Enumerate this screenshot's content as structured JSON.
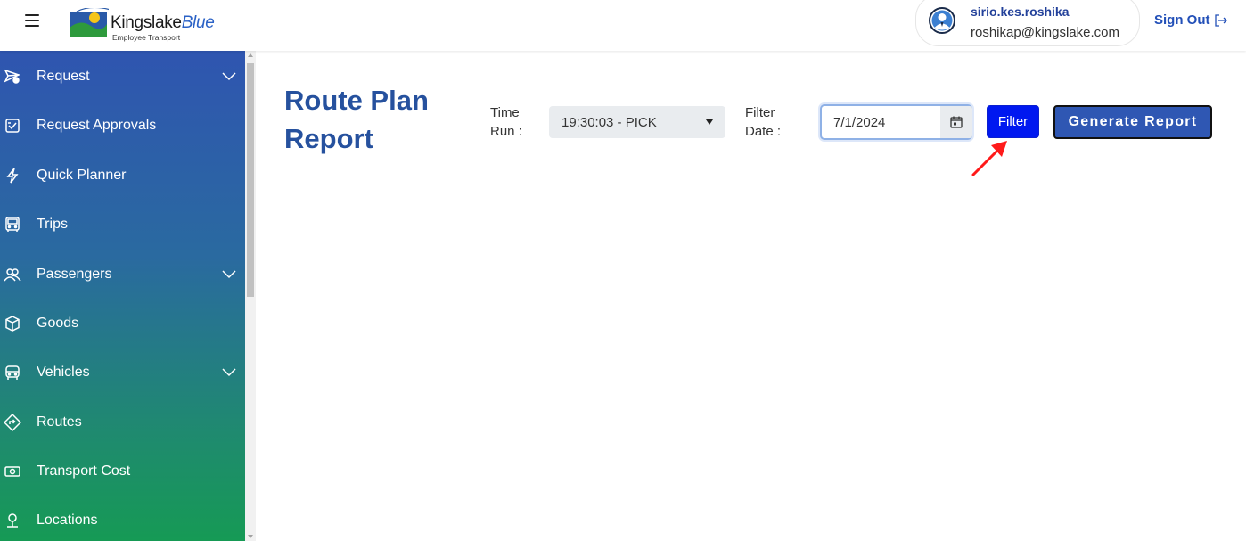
{
  "header": {
    "logo_name_main": "Kingslake",
    "logo_name_accent": "Blue",
    "logo_tagline": "Employee Transport",
    "user_name": "sirio.kes.roshika",
    "user_email": "roshikap@kingslake.com",
    "signout_label": "Sign Out"
  },
  "sidebar": {
    "items": [
      {
        "label": "Request",
        "icon": "paper-plane-icon",
        "expandable": true
      },
      {
        "label": "Request Approvals",
        "icon": "checkbox-icon",
        "expandable": false
      },
      {
        "label": "Quick Planner",
        "icon": "lightning-icon",
        "expandable": false
      },
      {
        "label": "Trips",
        "icon": "bus-front-icon",
        "expandable": false
      },
      {
        "label": "Passengers",
        "icon": "people-icon",
        "expandable": true
      },
      {
        "label": "Goods",
        "icon": "box-icon",
        "expandable": false
      },
      {
        "label": "Vehicles",
        "icon": "bus-icon",
        "expandable": true
      },
      {
        "label": "Routes",
        "icon": "sign-icon",
        "expandable": false
      },
      {
        "label": "Transport Cost",
        "icon": "cash-icon",
        "expandable": false
      },
      {
        "label": "Locations",
        "icon": "location-pin-icon",
        "expandable": false
      }
    ]
  },
  "main": {
    "title": "Route Plan Report",
    "time_run_label": "Time Run :",
    "time_run_value": "19:30:03 - PICK",
    "filter_date_label": "Filter Date :",
    "filter_date_value": "7/1/2024",
    "filter_button": "Filter",
    "generate_button": "Generate Report"
  },
  "colors": {
    "accent": "#26519e",
    "filter_button": "#0018f0",
    "generate_button": "#2f57b3",
    "annotation_arrow": "#ff1a1a"
  }
}
